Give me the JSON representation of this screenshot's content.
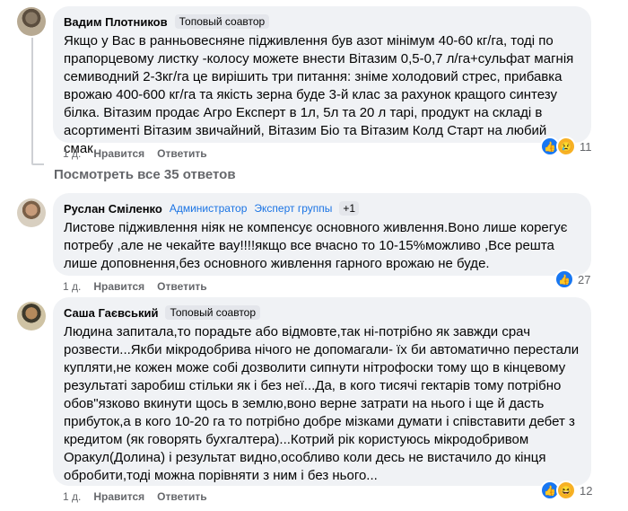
{
  "comments": [
    {
      "author": "Вадим Плотников",
      "badge": "Топовый соавтор",
      "text": "Якщо у Вас в ранньовесняне підживлення був азот мінімум 40-60 кг/га, тоді по прапорцевому листку -колосу можете внести Вітазим 0,5-0,7 л/га+сульфат магнія семиводний 2-3кг/га це вирішить три питання: зніме холодовий стрес, прибавка врожаю 400-600 кг/га та якість зерна буде 3-й клас за рахунок кращого синтезу білка. Вітазим продає Агро Експерт в 1л, 5л та 20 л тарі, продукт на складі в асортименті Вітазим звичайний, Вітазим Біо та Вітазим Колд Старт на любий смак.",
      "time": "1 д.",
      "like": "Нравится",
      "reply": "Ответить",
      "reaction_count": "11",
      "reactions": [
        "like-icon",
        "sad-icon"
      ]
    },
    {
      "author": "Руслан Сміленко",
      "badge": "Администратор",
      "badge2": "Эксперт группы",
      "badge_count": "+1",
      "text": "Листове підживлення ніяк не компенсує основного живлення.Воно лише корегує потребу ,але не чекайте вау!!!!якщо все вчасно то 10-15%можливо ,Все решта лише доповнення,без основного живлення гарного врожаю не буде.",
      "time": "1 д.",
      "like": "Нравится",
      "reply": "Ответить",
      "reaction_count": "27",
      "reactions": [
        "like-icon"
      ]
    },
    {
      "author": "Саша Гаєвський",
      "badge": "Топовый соавтор",
      "text": "Людина запитала,то порадьте або відмовте,так ні-потрібно як завжди срач розвести...Якби мікродобрива нічого не допомагали- їх би автоматично перестали купляти,не кожен може собі дозволити сипнути нітрофоски тому що в кінцевому результаті заробиш стільки як і без неї...Да, в кого тисячі гектарів тому потрібно обов\"язково вкинути щось в землю,воно верне затрати на нього і ще й дасть прибуток,а в кого 10-20 га то потрібно добре мізками думати і співставити дебет з кредитом (як говорять бухгалтера)...Котрий рік користуюсь мікродобривом Оракул(Долина) і результат видно,особливо коли десь не вистачило до кінця обробити,тоді можна порівняти з ним і без нього...",
      "time": "1 д.",
      "like": "Нравится",
      "reply": "Ответить",
      "reaction_count": "12",
      "reactions": [
        "like-icon",
        "haha-icon"
      ]
    }
  ],
  "more_replies": "Посмотреть все 35 ответов",
  "colors": {
    "bubble": "#f0f2f5",
    "meta": "#65676b",
    "link": "#1b74e4",
    "like": "#1877f2"
  }
}
